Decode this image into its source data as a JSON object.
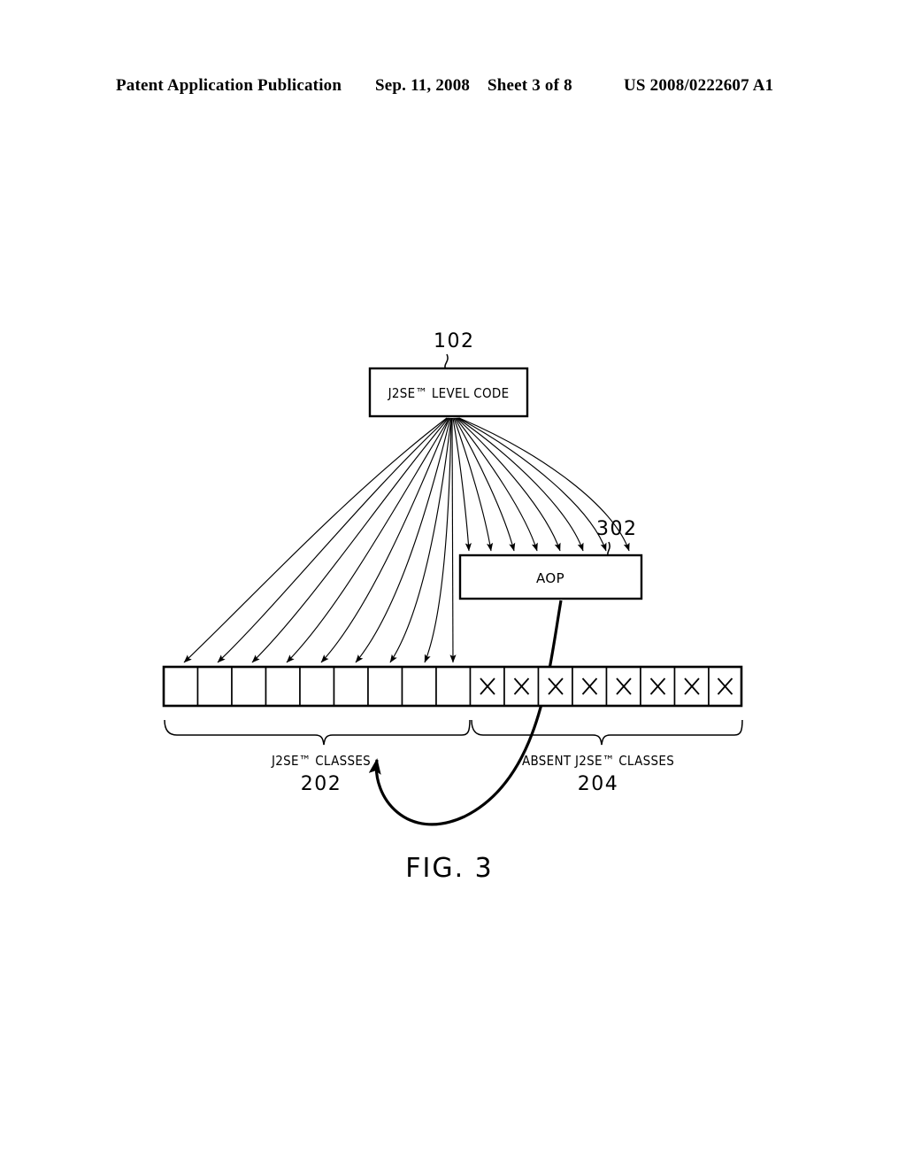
{
  "header": {
    "publication": "Patent Application Publication",
    "date": "Sep. 11, 2008",
    "sheet": "Sheet 3 of 8",
    "patent_number": "US 2008/0222607 A1"
  },
  "figure": {
    "caption": "FIG. 3",
    "boxes": [
      {
        "id": "j2se-level-code",
        "label": "J2SE™ LEVEL CODE",
        "ref": "102"
      },
      {
        "id": "aop",
        "label": "AOP",
        "ref": "302"
      }
    ],
    "groups": [
      {
        "id": "j2se-classes",
        "label": "J2SE™ CLASSES",
        "ref": "202",
        "cell_count": 9,
        "marked": false
      },
      {
        "id": "absent-j2se-classes",
        "label": "ABSENT J2SE™ CLASSES",
        "ref": "204",
        "cell_count": 8,
        "marked": true
      }
    ],
    "cell_mark": "×",
    "arrow_counts": {
      "to_classes": 9,
      "to_aop": 8
    }
  }
}
